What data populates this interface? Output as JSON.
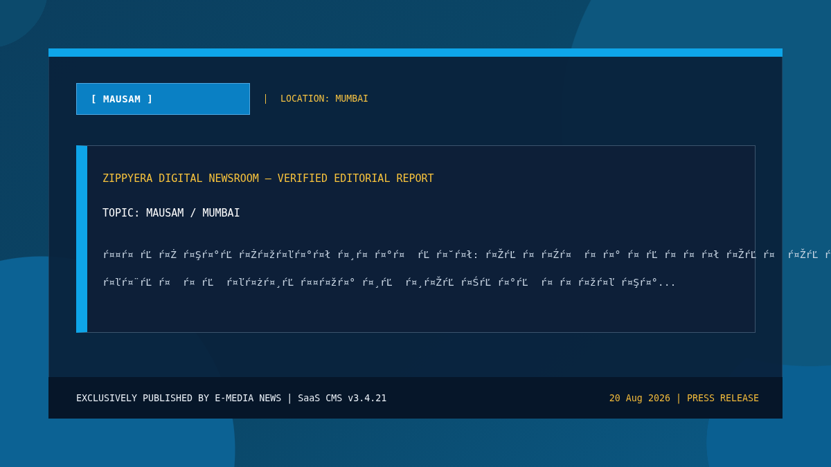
{
  "header": {
    "category": "[ MAUSAM ]",
    "location": "LOCATION: MUMBAI"
  },
  "article": {
    "headline": "ZIPPYERA DIGITAL NEWSROOM — VERIFIED EDITORIAL REPORT",
    "topic": "TOPIC: MAUSAM / MUMBAI",
    "body": "ŕ¤¤ŕ¤ ŕĽ ŕ¤Ż ŕ¤Şŕ¤°ŕĽ ŕ¤Żŕ¤žŕ¤ľŕ¤°ŕ¤ł ŕ¤¸ŕ¤ ŕ¤°ŕ¤  ŕĽ ŕ¤˘ŕ¤ł: ŕ¤ŽŕĽ ŕ¤ ŕ¤Źŕ¤  ŕ¤ ŕ¤° ŕ¤ ŕĽ ŕ¤ ŕ¤ ŕ¤ł ŕ¤ŽŕĽ ŕ¤  ŕ¤ŽŕĽ ŕ\nŕ¤ľŕ¤¨ŕĽ ŕ¤  ŕ¤ ŕĽ  ŕ¤ľŕ¤żŕ¤¸ŕĽ ŕ¤¤ŕ¤žŕ¤° ŕ¤¸ŕĽ  ŕ¤¸ŕ¤ŽŕĽ ŕ¤ŚŕĽ ŕ¤°ŕĽ  ŕ¤ ŕ¤ ŕ¤žŕ¤ľ ŕ¤Şŕ¤°..."
  },
  "footer": {
    "credit": "EXCLUSIVELY PUBLISHED BY E-MEDIA NEWS | SaaS CMS v3.4.21",
    "release": "20 Aug 2026 | PRESS RELEASE"
  }
}
